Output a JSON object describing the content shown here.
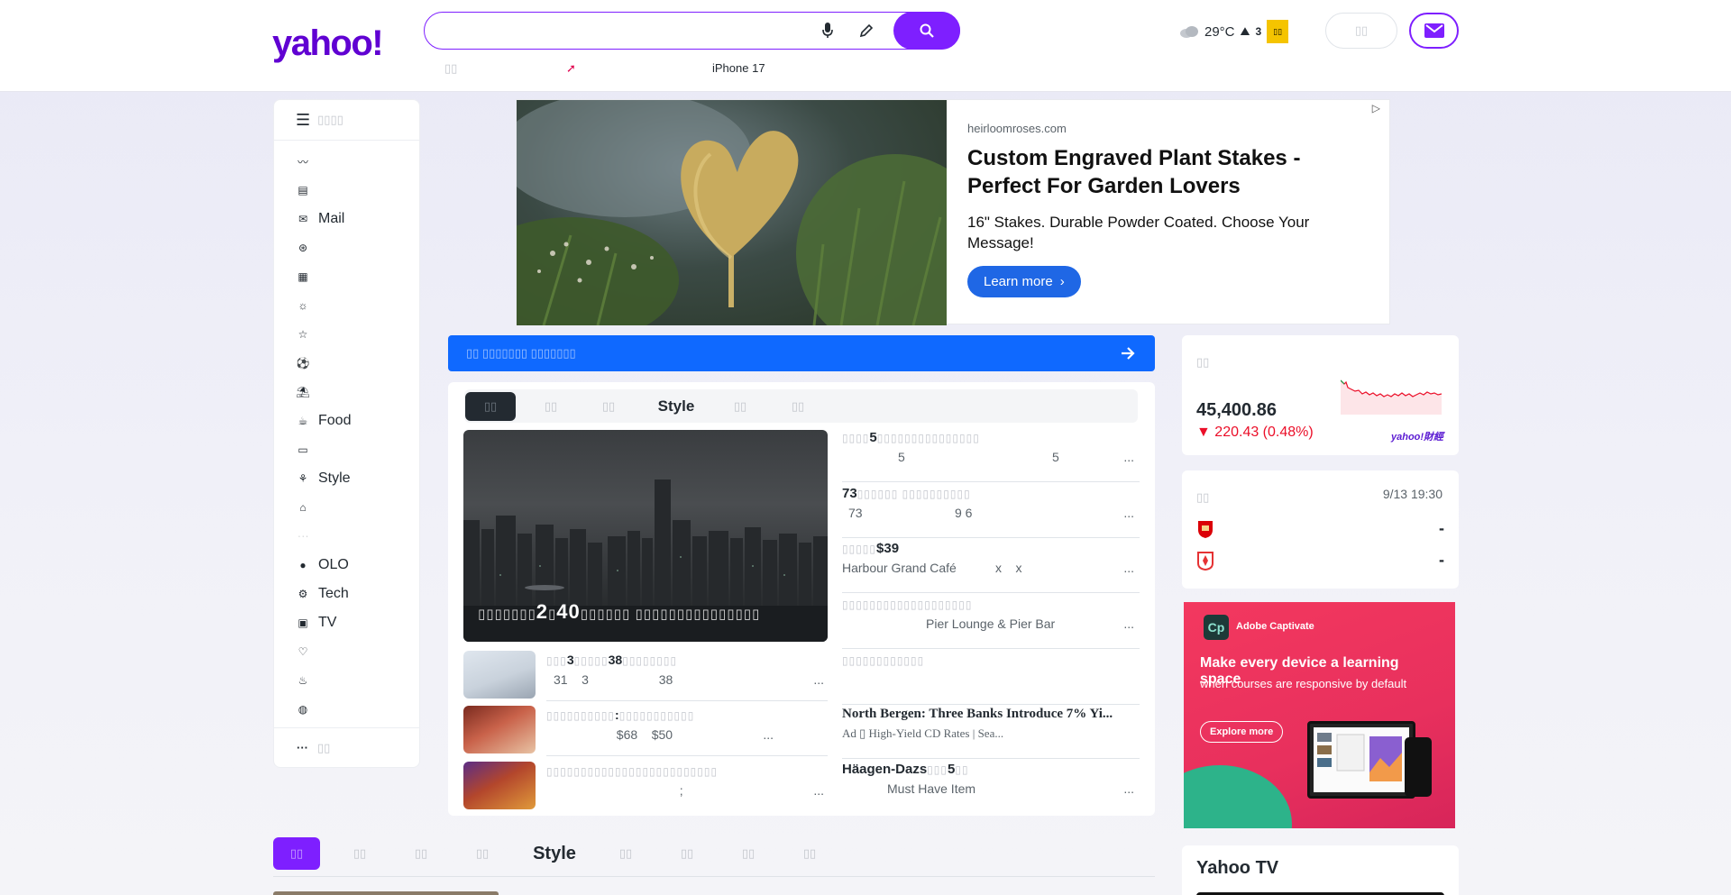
{
  "header": {
    "logo": "yahoo!",
    "search": {
      "value": "",
      "placeholder": ""
    },
    "trending": [
      {
        "label": "▯▯"
      },
      {
        "label": ""
      },
      {
        "label": "iPhone 17"
      }
    ],
    "weather": {
      "temp": "29°C",
      "uv": "3",
      "badge": "▯▯"
    },
    "signin_label": "▯▯"
  },
  "left_nav": {
    "menu_label": "▯▯▯▯",
    "items": [
      {
        "icon": "finance-icon",
        "label": ""
      },
      {
        "icon": "news-icon",
        "label": ""
      },
      {
        "icon": "mail-icon",
        "label": "Mail"
      },
      {
        "icon": "sports-icon",
        "label": ""
      },
      {
        "icon": "calendar-icon",
        "label": ""
      },
      {
        "icon": "weather-icon",
        "label": ""
      },
      {
        "icon": "star-icon",
        "label": ""
      },
      {
        "icon": "soccer-icon",
        "label": ""
      },
      {
        "icon": "travel-icon",
        "label": ""
      },
      {
        "icon": "food-icon",
        "label": "Food"
      },
      {
        "icon": "ticket-icon",
        "label": ""
      },
      {
        "icon": "style-icon",
        "label": "Style"
      },
      {
        "icon": "shopping-icon",
        "label": ""
      },
      {
        "icon": "bubble-icon",
        "label": ""
      },
      {
        "icon": "olo-icon",
        "label": "OLO"
      },
      {
        "icon": "tech-icon",
        "label": "Tech"
      },
      {
        "icon": "tv-icon",
        "label": "TV"
      },
      {
        "icon": "health-icon",
        "label": ""
      },
      {
        "icon": "cake-icon",
        "label": ""
      },
      {
        "icon": "globe-icon",
        "label": ""
      }
    ],
    "more_label": "▯▯"
  },
  "ad_top": {
    "domain": "heirloomroses.com",
    "title": "Custom Engraved Plant Stakes - Perfect For Garden Lovers",
    "description": "16\" Stakes. Durable Powder Coated. Choose Your Message!",
    "cta": "Learn more"
  },
  "blue_bar": {
    "label": "▯▯ ▯▯▯▯▯▯▯ ▯▯▯▯▯▯▯"
  },
  "news": {
    "tabs": [
      {
        "label": "▯▯"
      },
      {
        "label": "▯▯"
      },
      {
        "label": "▯▯"
      },
      {
        "label": "Style"
      },
      {
        "label": "▯▯"
      },
      {
        "label": "▯▯"
      }
    ],
    "hero": {
      "prefix": "▯▯▯▯▯▯▯",
      "num1": "2",
      "mid": "▯",
      "num2": "40",
      "suffix": "▯▯▯▯▯▯ ▯▯▯▯▯▯▯▯▯▯▯▯▯▯▯"
    },
    "right_stories": [
      {
        "title_pre": "▯▯▯▯",
        "title_bold": "5",
        "title_post": "▯▯▯▯▯▯▯▯▯▯▯▯▯▯▯",
        "meta_a": "5",
        "meta_b": "5",
        "dots": "..."
      },
      {
        "title_pre": "",
        "title_bold": "73",
        "title_post": "▯▯▯▯▯▯ ▯▯▯▯▯▯▯▯▯▯",
        "meta_a": "73",
        "meta_b": "9 6",
        "dots": "..."
      },
      {
        "title_pre": "▯▯▯▯▯",
        "title_bold": "$39",
        "title_post": "",
        "meta_a": "Harbour Grand Café",
        "meta_b": "x    x",
        "dots": "..."
      },
      {
        "title_pre": "▯▯▯▯▯▯▯▯▯▯▯▯▯▯▯▯▯▯▯",
        "title_bold": "",
        "title_post": "",
        "meta_a": "Pier Lounge & Pier Bar",
        "meta_b": "",
        "dots": "..."
      },
      {
        "title_pre": "▯▯▯▯▯▯▯▯▯▯▯▯",
        "title_bold": "",
        "title_post": "",
        "meta_a": "",
        "meta_b": "",
        "dots": ""
      },
      {
        "title_pre": "",
        "title_bold": "North Bergen: Three Banks Introduce 7% Yi...",
        "title_post": "",
        "meta_a": "Ad ▯ High-Yield CD Rates | Sea...",
        "meta_b": "",
        "dots": ""
      },
      {
        "title_pre": "",
        "title_bold": "Häagen-Dazs",
        "title_post": "▯▯▯",
        "title_bold2": "5",
        "title_post2": "▯▯",
        "meta_a": "Must Have Item",
        "meta_b": "",
        "dots": "..."
      }
    ],
    "left_stories": [
      {
        "t_pre": "▯▯▯",
        "t_b1": "3",
        "t_mid": "▯▯▯▯▯",
        "t_b2": "38",
        "t_post": "▯▯▯▯▯▯▯▯",
        "meta": "31    3                    38",
        "dots": "..."
      },
      {
        "t_pre": "▯▯▯▯▯▯▯▯▯▯",
        "t_b1": ":",
        "t_mid": "▯▯▯▯▯▯▯▯▯▯▯",
        "t_b2": "",
        "t_post": "",
        "meta": "                    $68    $50",
        "dots": "..."
      },
      {
        "t_pre": "▯▯▯▯▯▯▯▯▯▯▯▯▯▯▯▯▯▯▯▯▯▯▯▯▯",
        "t_b1": "",
        "t_mid": "",
        "t_b2": "",
        "t_post": "",
        "meta": "                                      ;",
        "dots": "..."
      }
    ]
  },
  "stock": {
    "label": "▯▯",
    "value": "45,400.86",
    "change": "220.43 (0.48%)",
    "brand": "yahoo!財經"
  },
  "match": {
    "label": "▯▯",
    "time": "9/13 19:30",
    "home_score": "-",
    "away_score": "-"
  },
  "ad_side": {
    "brand": "Adobe Captivate",
    "logo": "Cp",
    "headline": "Make every device a learning space",
    "sub": "when courses are responsive by default",
    "cta": "Explore more"
  },
  "tv": {
    "title": "Yahoo TV"
  },
  "bottom_tabs": [
    {
      "label": "▯▯"
    },
    {
      "label": "▯▯"
    },
    {
      "label": "▯▯"
    },
    {
      "label": "▯▯"
    },
    {
      "label": "Style"
    },
    {
      "label": "▯▯"
    },
    {
      "label": "▯▯"
    },
    {
      "label": "▯▯"
    },
    {
      "label": "▯▯"
    }
  ],
  "colors": {
    "brand": "#6001d2",
    "accent": "#7e1fff",
    "down": "#eb0f29",
    "blue": "#0f69ff"
  }
}
